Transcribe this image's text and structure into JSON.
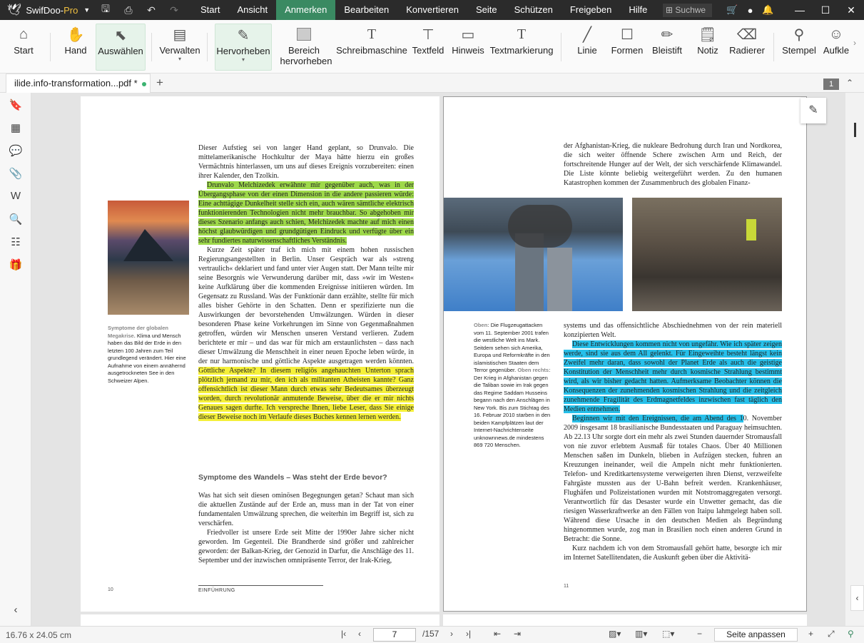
{
  "app": {
    "name": "SwifDoo-",
    "pro": "Pro"
  },
  "menu": [
    "Start",
    "Ansicht",
    "Anmerken",
    "Bearbeiten",
    "Konvertieren",
    "Seite",
    "Schützen",
    "Freigeben",
    "Hilfe"
  ],
  "search_placeholder": "Suchwe",
  "ribbon": {
    "start": "Start",
    "hand": "Hand",
    "select": "Auswählen",
    "manage": "Verwalten",
    "highlight": "Hervorheben",
    "area1": "Bereich",
    "area2": "hervorheben",
    "typewriter": "Schreibmaschine",
    "textfield": "Textfeld",
    "note": "Hinweis",
    "textmark": "Textmarkierung",
    "line": "Linie",
    "shapes": "Formen",
    "pencil": "Bleistift",
    "notes": "Notiz",
    "eraser": "Radierer",
    "stamp": "Stempel",
    "sticker": "Aufkle"
  },
  "tab": {
    "file": "ilide.info-transformation...pdf *"
  },
  "page_badge": "1",
  "left_page": {
    "p1": "Dieser Aufstieg sei von langer Hand geplant, so Drunvalo. Die mittelamerikanische Hochkultur der Maya hätte hierzu ein großes Vermächtnis hinterlassen, um uns auf dieses Ereignis vorzubereiten: einen ihrer Kalender, den Tzolkin.",
    "p2": "Drunvalo Melchizedek erwähnte mir gegenüber auch, was in der Übergangsphase von der einen Dimension in die andere passieren würde: Eine achttägige Dunkelheit stelle sich ein, auch wären sämtliche elektrisch funktionierenden Technologien nicht mehr brauchbar. So abgehoben mir dieses Szenario anfangs auch schien, Melchizedek machte auf mich einen höchst glaubwürdigen und grundgütigen Eindruck und verfügte über ein sehr fundiertes naturwissenschaftliches Verständnis.",
    "p3": "Kurze Zeit später traf ich mich mit einem hohen russischen Regierungsangestellten in Berlin. Unser Gespräch war als »streng vertraulich« deklariert und fand unter vier Augen statt. Der Mann teilte mir seine Besorgnis wie Verwunderung darüber mit, dass »wir im Westen« keine Aufklärung über die kommenden Ereignisse initiieren würden. Im Gegensatz zu Russland. Was der Funktionär dann erzählte, stellte für mich alles bisher Gehörte in den Schatten. Denn er spezifizierte nun die Auswirkungen der bevorstehenden Umwälzungen. Würden in dieser besonderen Phase keine Vorkehrungen im Sinne von Gegenmaßnahmen getroffen, würden wir Menschen unseren Verstand verlieren. Zudem berichtete er mir – und das war für mich am erstaunlichsten – dass nach dieser Umwälzung die Menschheit in einer neuen Epoche leben würde, in der nur harmonische und göttliche Aspekte ausgetragen werden könnten.",
    "p3h": "Göttliche Aspekte? In diesem religiös angehauchten Unterton sprach plötzlich jemand zu mir, den ich als militanten Atheisten kannte? Ganz offensichtlich ist dieser Mann durch etwas sehr Bedeutsames überzeugt worden, durch revolutionär anmutende Beweise, über die er mir nichts Genaues sagen durfte. Ich verspreche Ihnen, liebe Leser, dass Sie einige dieser Beweise noch im Verlaufe dieses Buches kennen lernen werden.",
    "caption_title": "Symptome der globalen Megakrise.",
    "caption_body": "Klima und Mensch haben das Bild der Erde in den letzten 100 Jahren zum Teil grundlegend verändert. Hier eine Aufnahme von einem annähernd ausgetrockneten See in den Schweizer Alpen.",
    "section": "Symptome des Wandels – Was steht der Erde bevor?",
    "p4": "Was hat sich seit diesen ominösen Begegnungen getan? Schaut man sich die aktuellen Zustände auf der Erde an, muss man in der Tat von einer fundamentalen Umwälzung sprechen, die weiterhin im Begriff ist, sich zu verschärfen.",
    "p5": "Friedvoller ist unsere Erde seit Mitte der 1990er Jahre sicher nicht geworden. Im Gegenteil. Die Brandherde sind größer und zahlreicher geworden: der Balkan-Krieg, der Genozid in Darfur, die Anschläge des 11. September und der inzwischen omnipräsente Terror, der Irak-Krieg,",
    "pagenum": "10",
    "footer": "EINFÜHRUNG"
  },
  "right_page": {
    "p1": "der Afghanistan-Krieg, die nukleare Bedrohung durch Iran und Nordkorea, die sich weiter öffnende Schere zwischen Arm und Reich, der fortschreitende Hunger auf der Welt, der sich verschärfende Klimawandel. Die Liste könnte beliebig weitergeführt werden. Zu den humanen Katastrophen kommen der Zusammenbruch des globalen Finanz-",
    "cap_top_label": "Oben:",
    "cap_top": "Die Flugzeugattacken vom 11. September 2001 trafen die westliche Welt ins Mark. Seitdem sehen sich Amerika, Europa und Reformkräfte in den islamistischen Staaten dem Terror gegenüber.",
    "cap_right_label": "Oben rechts:",
    "cap_right": "Der Krieg in Afghanistan gegen die Taliban sowie im Irak gegen das Regime Saddam Husseins begann nach den Anschlägen in New York. Bis zum Stichtag des 16. Februar 2010 starben in den beiden Kampfplätzen laut der Internet-Nachrichtenseite unknownnews.de mindestens 869 720 Menschen.",
    "p2": "systems und das offensichtliche Abschiednehmen von der rein materiell konzipierten Welt.",
    "p3h": "Diese Entwicklungen kommen nicht von ungefähr. Wie ich später zeigen werde, sind sie aus dem All gelenkt. Für Eingeweihte besteht längst kein Zweifel mehr daran, dass sowohl der Planet Erde als auch die geistige Konstitution der Menschheit mehr durch kosmische Strahlung bestimmt wird, als wir bisher gedacht hatten. Aufmerksame Beobachter können die Konsequenzen der zunehmenden kosmischen Strahlung und die zeitgleich zunehmende Fragilität des Erdmagnetfeldes inzwischen fast täglich den Medien entnehmen.",
    "p4h": "Beginnen wir mit den Ereignissen, die am Abend des 1",
    "p4": "0. November 2009 insgesamt 18 brasilianische Bundesstaaten und Paraguay heimsuchten. Ab 22.13 Uhr sorgte dort ein mehr als zwei Stunden dauernder Stromausfall von nie zuvor erlebtem Ausmaß für totales Chaos. Über 40 Millionen Menschen saßen im Dunkeln, blieben in Aufzügen stecken, fuhren an Kreuzungen ineinander, weil die Ampeln nicht mehr funktionierten. Telefon- und Kreditkartensysteme verweigerten ihren Dienst, verzweifelte Fahrgäste mussten aus der U-Bahn befreit werden. Krankenhäuser, Flughäfen und Polizeistationen wurden mit Notstromaggregaten versorgt. Verantwortlich für das Desaster wurde ein Unwetter gemacht, das die riesigen Wasserkraftwerke an den Fällen von Itaipu lahmgelegt haben soll. Während diese Ursache in den deutschen Medien als Begründung hingenommen wurde, zog man in Brasilien noch einen anderen Grund in Betracht: die Sonne.",
    "p5": "Kurz nachdem ich von dem Stromausfall gehört hatte, besorgte ich mir im Internet Satellitendaten, die Auskunft geben über die Aktivitä-",
    "pagenum": "11"
  },
  "status": {
    "dimensions": "16.76 x 24.05 cm",
    "page": "7",
    "total": "/157",
    "fit": "Seite anpassen"
  },
  "colors": {
    "accent": "#3a8a62",
    "highlight_green": "#9ed94a",
    "highlight_yellow": "#f5f03a",
    "highlight_blue": "#27c0ea"
  }
}
